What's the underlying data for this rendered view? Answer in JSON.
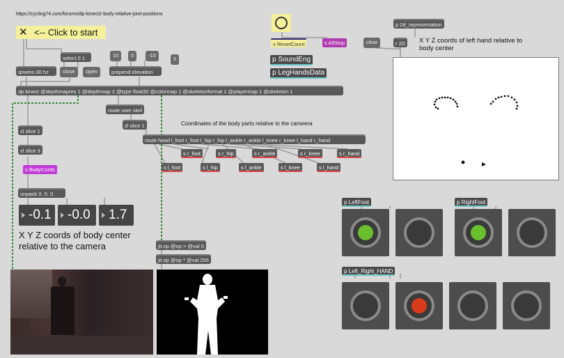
{
  "url_comment": "https://cycling74.com/forums/dp-kinect2-body-relative-joint-positions",
  "toggle_label": "<-- Click to start",
  "toggle_glyph": "✕",
  "objects": {
    "select": "select 0 1",
    "qmetro": "qmetro 30 hz",
    "close": "close",
    "open": "open",
    "n10": "10",
    "n0": "0",
    "nm10": "-10",
    "n5": "5",
    "prepend": "prepend elevation",
    "dpkinect": "dp.kinect @depthmapres 1 @depthmap 2 @type float32 @colormap 1 @skeletonformat 1 @playermap 1 @skeleton 1",
    "route_user": "route user skel",
    "zl_slice_1a": "zl slice 1",
    "zl_slice_1b": "zl slice 1",
    "zl_slice_3": "zl slice 3",
    "route_joints": "route head l_foot r_foot l_hip r_hip l_ankle r_ankle l_knee r_knee l_hand r_hand",
    "unpack": "unpack 0. 0. 0.",
    "jit_op_gt": "jit.op @op > @val 0",
    "jit_op_mul": "jit.op @op * @val 255",
    "clear": "clear",
    "r2d": "r 2D",
    "p2d": "p 2d_representation",
    "p_soundeng": "p SoundEng",
    "p_leghands": "p LegHandsData"
  },
  "sends": {
    "reset_count": "s ResetCount",
    "all_stop": "s AllStop",
    "body_cords": "s BodyCords",
    "r_foot": "s r_foot",
    "r_hip": "s r_hip",
    "r_ankle": "s r_ankle",
    "r_knee": "s r_knee",
    "r_hand": "s r_hand",
    "l_foot": "s l_foot",
    "l_hip": "s l_hip",
    "l_ankle": "s l_ankle",
    "l_knee": "s l_knee",
    "l_hand": "s l_hand"
  },
  "labels": {
    "coords_title": "Coordinates of the body parts relative to the cameera",
    "body_center": "X Y Z coords of body center relative to the camera",
    "left_hand": "X Y Z coords of left hand relative to body center"
  },
  "numbers": {
    "x": "-0.1",
    "y": "-0.0",
    "z": "1.7"
  },
  "bpatchers": {
    "left_foot": "p LeftFoot",
    "right_foot": "p RightFoot",
    "hands": "p Left_Right_HAND"
  },
  "led_colors": {
    "on_green": "#6abf2e",
    "on_red": "#d93a1a",
    "off": "#3a3a3a"
  }
}
